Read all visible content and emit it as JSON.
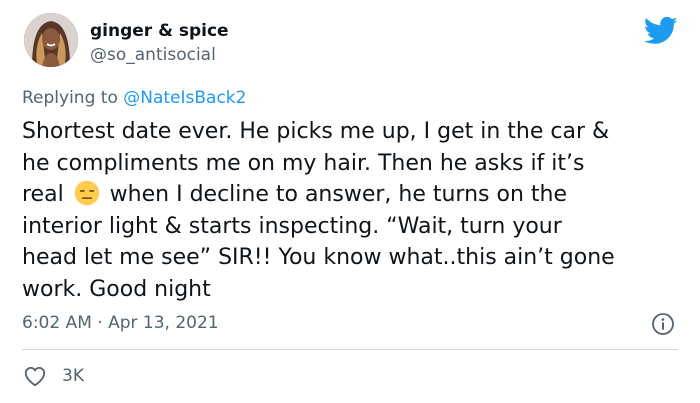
{
  "author": {
    "display_name": "ginger & spice",
    "handle": "@so_antisocial"
  },
  "reply": {
    "prefix": "Replying to ",
    "mention": "@NateIsBack2"
  },
  "tweet": {
    "lines": [
      "Shortest date ever. He picks me up, I get in the car &",
      "he compliments me on my hair. Then he asks if it’s",
      "when I decline to answer, he turns on the",
      "interior light & starts inspecting. “Wait, turn your",
      "head let me see” SIR!! You know what..this ain’t gone",
      "work. Good night"
    ],
    "line3_prefix": "real",
    "emoji": "expressionless-face-emoji"
  },
  "meta": {
    "timestamp": "6:02 AM · Apr 13, 2021"
  },
  "actions": {
    "like_count": "3K"
  },
  "icons": {
    "brand": "twitter-bird-icon",
    "info": "info-icon",
    "like": "heart-icon"
  },
  "colors": {
    "brand_blue": "#1d9bf0",
    "text_primary": "#0f1419",
    "text_secondary": "#536471",
    "divider": "#cfd9de"
  }
}
